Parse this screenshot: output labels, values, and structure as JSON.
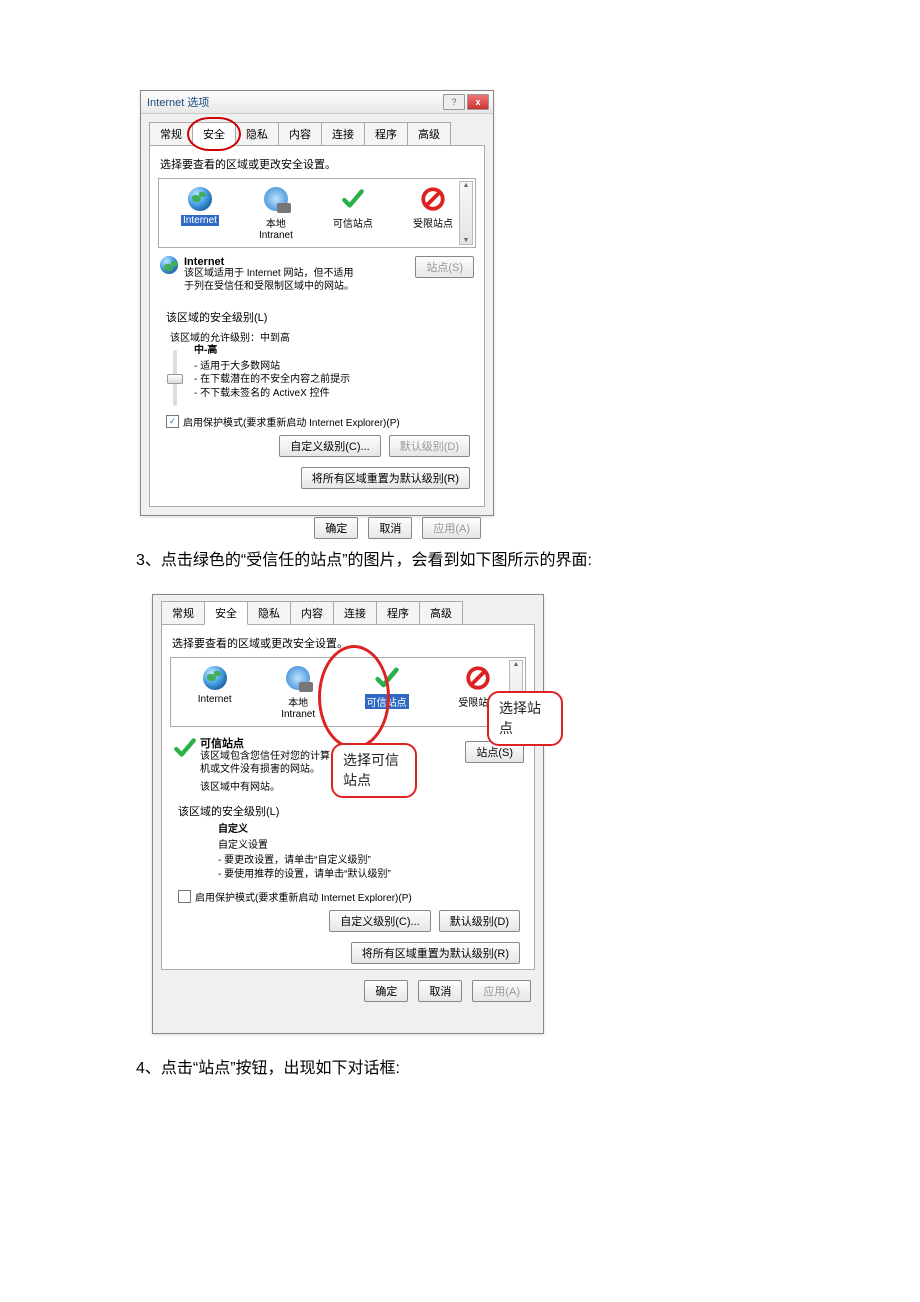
{
  "dialog": {
    "title": "Internet 选项",
    "help_btn": "?",
    "close_btn": "x",
    "tabs": [
      "常规",
      "安全",
      "隐私",
      "内容",
      "连接",
      "程序",
      "高级"
    ],
    "zone_instruction": "选择要查看的区域或更改安全设置。",
    "zones": {
      "internet": "Internet",
      "intranet_line1": "本地",
      "intranet_line2": "Intranet",
      "trusted": "可信站点",
      "restricted": "受限站点"
    },
    "sites_btn_disabled": "站点(S)",
    "sites_btn": "站点(S)",
    "zone1": {
      "title": "Internet",
      "desc": "该区域适用于 Internet 网站，但不适用于列在受信任和受限制区域中的网站。"
    },
    "zone2": {
      "title": "可信站点",
      "desc1": "该区域包含您信任对您的计算机或文件没有损害的网站。",
      "desc2": "该区域中有网站。"
    },
    "sec_group_title": "该区域的安全级别(L)",
    "allowed_levels": "该区域的允许级别：中到高",
    "level_head": "中-高",
    "level_bullets": [
      "适用于大多数网站",
      "在下载潜在的不安全内容之前提示",
      "不下载未签名的 ActiveX 控件"
    ],
    "custom_head": "自定义",
    "custom_sub": "自定义设置",
    "custom_bullets": [
      "要更改设置，请单击“自定义级别”",
      "要使用推荐的设置，请单击“默认级别”"
    ],
    "protected_mode": "启用保护模式(要求重新启动 Internet Explorer)(P)",
    "btn_custom": "自定义级别(C)...",
    "btn_default": "默认级别(D)",
    "btn_reset": "将所有区域重置为默认级别(R)",
    "btn_ok": "确定",
    "btn_cancel": "取消",
    "btn_apply": "应用(A)"
  },
  "doc": {
    "step3": "3、点击绿色的“受信任的站点”的图片，会看到如下图所示的界面:",
    "step4": "4、点击“站点”按钮，出现如下对话框:",
    "callout_trusted": "选择可信站点",
    "callout_sites": "选择站点"
  }
}
